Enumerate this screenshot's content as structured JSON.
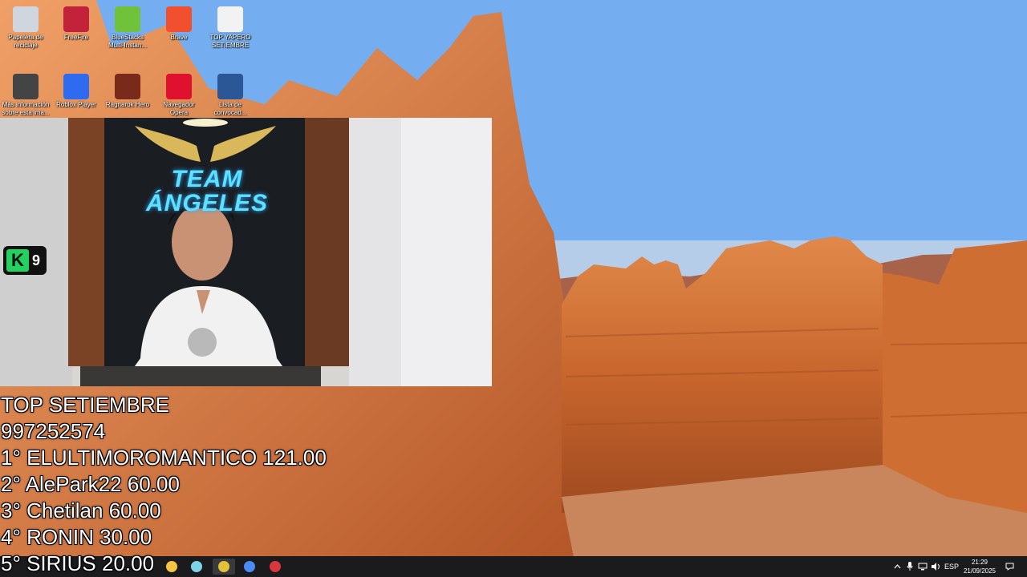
{
  "desktop": {
    "icons": [
      {
        "id": "recycle-bin",
        "label": "Papelera de reciclaje",
        "icon": "recycle-bin-icon",
        "color": "#cfd6de"
      },
      {
        "id": "freefire",
        "label": "FreeFire",
        "icon": "freefire-icon",
        "color": "#c2233b"
      },
      {
        "id": "bluestacks",
        "label": "BlueStacks Multi-Instan...",
        "icon": "bluestacks-icon",
        "color": "#6fc23a"
      },
      {
        "id": "brave",
        "label": "Brave",
        "icon": "brave-icon",
        "color": "#f1502f"
      },
      {
        "id": "top-yapero",
        "label": "TOP YAPERO SETIEMBRE",
        "icon": "text-document-icon",
        "color": "#f2f2f2"
      },
      {
        "id": "more-info",
        "label": "Más información sobre esta ima...",
        "icon": "camera-icon",
        "color": "#444444"
      },
      {
        "id": "roblox-player",
        "label": "Roblox Player",
        "icon": "roblox-icon",
        "color": "#2e6bf0"
      },
      {
        "id": "ragnarok",
        "label": "Ragnarok Hero",
        "icon": "ragnarok-icon",
        "color": "#7a2a1a"
      },
      {
        "id": "opera",
        "label": "Navegador Opera",
        "icon": "opera-icon",
        "color": "#e0102f"
      },
      {
        "id": "word-list",
        "label": "Lista de convocad...",
        "icon": "word-icon",
        "color": "#2b5797"
      }
    ]
  },
  "webcam": {
    "sign_text": "TEAM ÁNGELES",
    "badge": {
      "letter": "K",
      "number": "9"
    }
  },
  "overlay": {
    "title": "TOP  SETIEMBRE",
    "phone": "997252574",
    "ranking": [
      "1° ELULTIMOROMANTICO  121.00",
      "2° AlePark22 60.00",
      "3° Chetilan 60.00",
      "4° RONIN 30.00",
      "5° SIRIUS 20.00"
    ]
  },
  "taskbar": {
    "apps": [
      {
        "name": "file-explorer",
        "color": "#f5c542"
      },
      {
        "name": "notepad",
        "color": "#7fd3e8"
      },
      {
        "name": "chrome",
        "color": "#e3c23a",
        "active": true
      },
      {
        "name": "chrome-profile",
        "color": "#4c8bf5"
      },
      {
        "name": "obs",
        "color": "#d9363e"
      }
    ],
    "tray": {
      "language": "ESP",
      "time": "21:29",
      "date": "21/09/2025"
    }
  }
}
